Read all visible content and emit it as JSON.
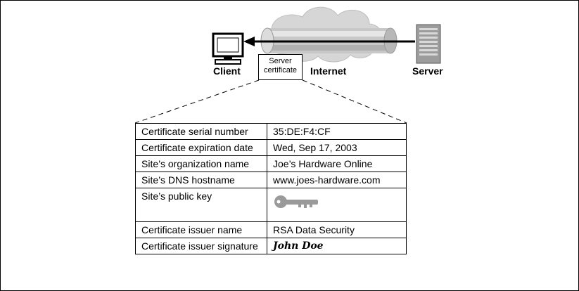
{
  "labels": {
    "client": "Client",
    "internet": "Internet",
    "server": "Server",
    "server_certificate_line1": "Server",
    "server_certificate_line2": "certificate"
  },
  "certificate": {
    "rows": [
      {
        "field": "Certificate serial number",
        "value": "35:DE:F4:CF"
      },
      {
        "field": "Certificate expiration date",
        "value": "Wed, Sep 17, 2003"
      },
      {
        "field": "Site’s organization name",
        "value": "Joe’s Hardware Online"
      },
      {
        "field": "Site’s DNS hostname",
        "value": "www.joes-hardware.com"
      },
      {
        "field": "Site’s public key",
        "value_icon": "key-icon"
      },
      {
        "field": "Certificate issuer name",
        "value": "RSA Data Security"
      },
      {
        "field": "Certificate issuer signature",
        "value": "John Doe"
      }
    ]
  },
  "colors": {
    "cloud_fill": "#d6d6d6",
    "tube_fill": "#c4c4c4",
    "key_fill": "#9a9a9a",
    "server_fill": "#9c9c9c"
  }
}
